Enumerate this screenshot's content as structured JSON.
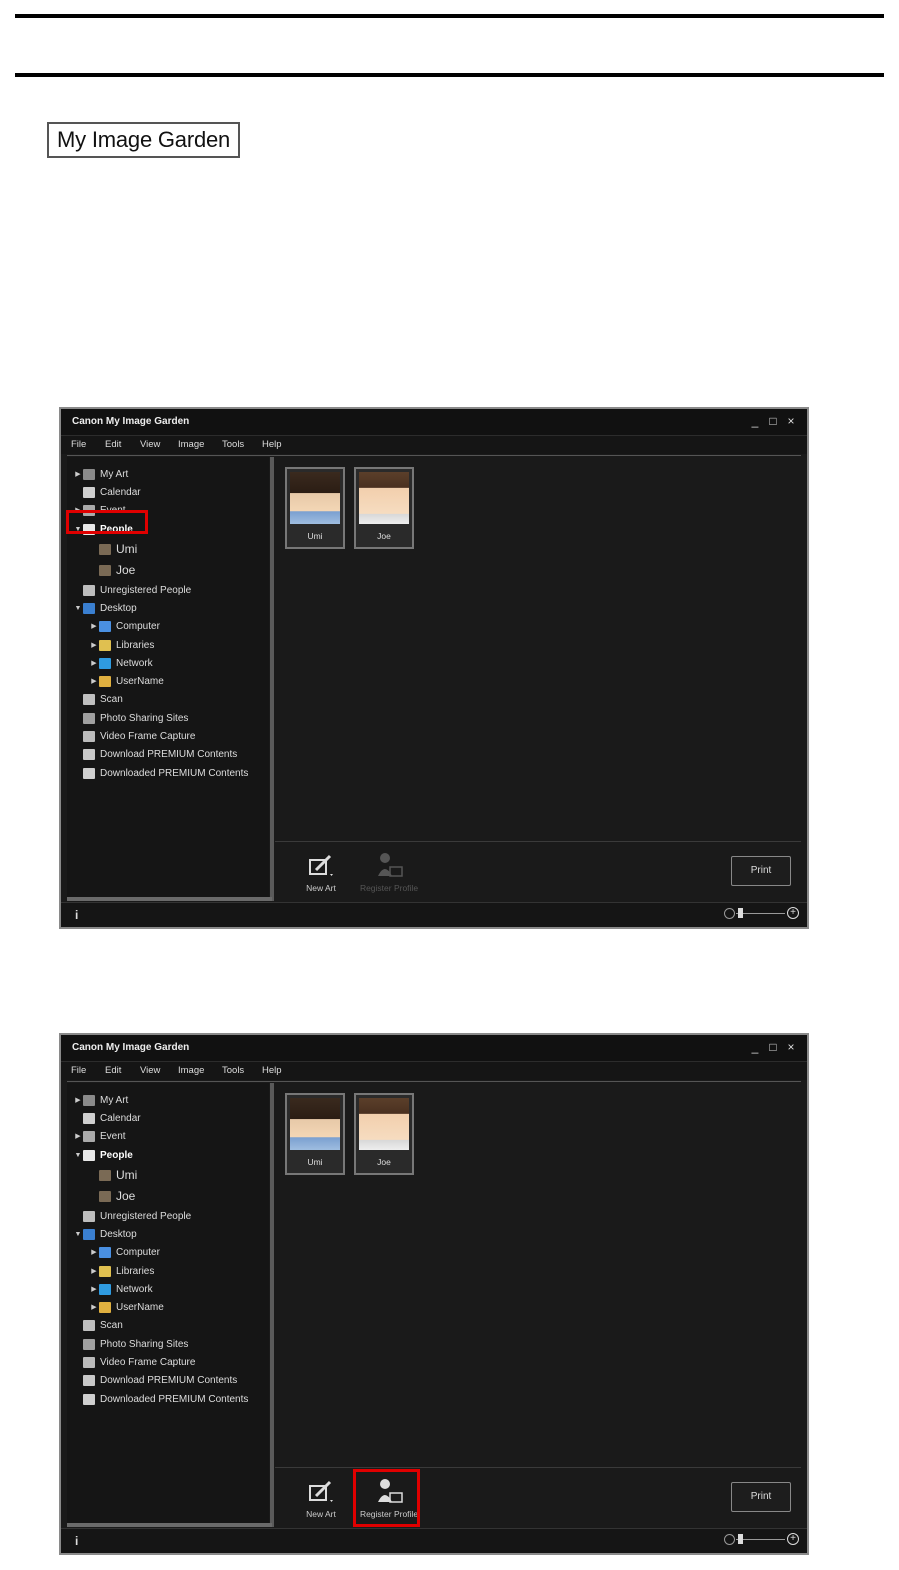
{
  "badge": "My Image Garden",
  "window": {
    "title": "Canon My Image Garden",
    "controls": [
      "_",
      "□",
      "×"
    ],
    "menu": [
      "File",
      "Edit",
      "View",
      "Image",
      "Tools",
      "Help"
    ],
    "tree": [
      {
        "label": "My Art",
        "icon": "my-art-icon"
      },
      {
        "label": "Calendar",
        "icon": "calendar-icon"
      },
      {
        "label": "Event",
        "icon": "event-icon"
      },
      {
        "label": "People",
        "icon": "person-icon"
      },
      {
        "label": "Umi",
        "icon": "photo-thumb-icon"
      },
      {
        "label": "Joe",
        "icon": "photo-thumb-icon"
      },
      {
        "label": "Unregistered People",
        "icon": "unregistered-person-icon"
      },
      {
        "label": "Desktop",
        "icon": "desktop-icon"
      },
      {
        "label": "Computer",
        "icon": "computer-icon"
      },
      {
        "label": "Libraries",
        "icon": "libraries-icon"
      },
      {
        "label": "Network",
        "icon": "network-icon"
      },
      {
        "label": "UserName",
        "icon": "user-folder-icon"
      },
      {
        "label": "Scan",
        "icon": "scan-icon"
      },
      {
        "label": "Photo Sharing Sites",
        "icon": "photo-sharing-icon"
      },
      {
        "label": "Video Frame Capture",
        "icon": "video-frame-icon"
      },
      {
        "label": "Download PREMIUM Contents",
        "icon": "download-icon"
      },
      {
        "label": "Downloaded PREMIUM Contents",
        "icon": "folder-icon"
      }
    ],
    "thumbs": [
      {
        "caption": "Umi"
      },
      {
        "caption": "Joe"
      }
    ],
    "toolbar": {
      "new_art": "New Art",
      "register_profile": "Register Profile",
      "print": "Print"
    },
    "status": {
      "info": "i"
    },
    "colors": {
      "highlight": "#e00000",
      "background": "#1a1a1a"
    }
  }
}
